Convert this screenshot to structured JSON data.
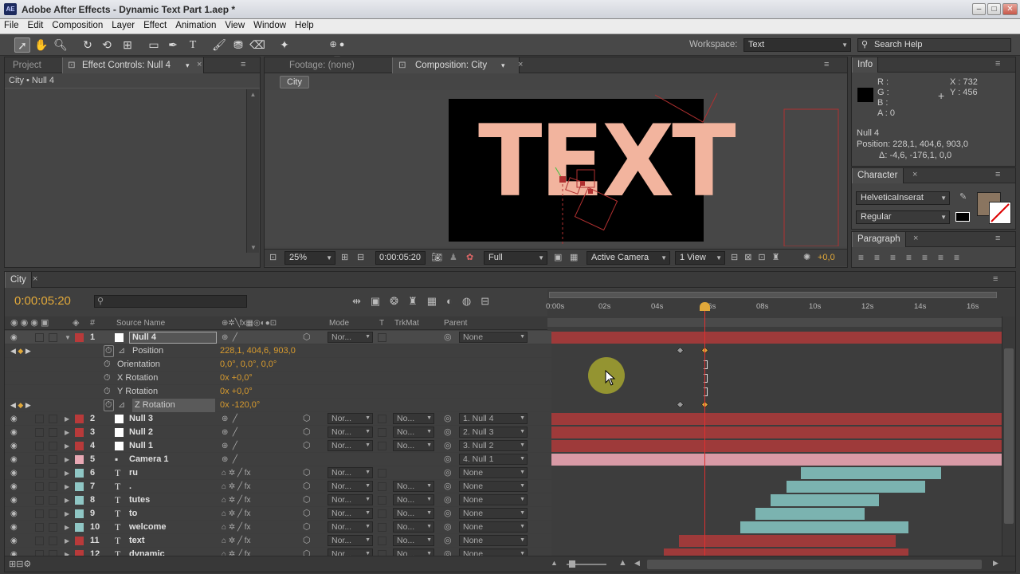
{
  "app": {
    "icon_text": "AE",
    "title": "Adobe After Effects - Dynamic Text Part 1.aep *"
  },
  "window_controls": [
    "–",
    "□",
    "✕"
  ],
  "menu": [
    "File",
    "Edit",
    "Composition",
    "Layer",
    "Effect",
    "Animation",
    "View",
    "Window",
    "Help"
  ],
  "toolbar": {
    "workspace_label": "Workspace:",
    "workspace_value": "Text",
    "search_placeholder": "Search Help"
  },
  "effect_controls": {
    "tab_project": "Project",
    "tab_effects": "Effect Controls: Null 4",
    "breadcrumb": "City • Null 4"
  },
  "composition": {
    "tab_footage": "Footage: (none)",
    "tab_comp": "Composition: City",
    "crumb": "City",
    "canvas_text": "TEXT",
    "zoom": "25%",
    "timecode": "0:00:05:20",
    "resolution": "Full",
    "camera": "Active Camera",
    "view": "1 View",
    "exposure": "+0,0"
  },
  "info": {
    "tab": "Info",
    "r": "R :",
    "g": "G :",
    "b": "B :",
    "a": "A : 0",
    "x": "X : 732",
    "y": "Y : 456",
    "layer": "Null 4",
    "position": "Position: 228,1, 404,6, 903,0",
    "delta": "Δ: -4,6, -176,1, 0,0"
  },
  "character": {
    "tab": "Character",
    "font": "HelveticaInserat",
    "style": "Regular"
  },
  "paragraph": {
    "tab": "Paragraph"
  },
  "timeline": {
    "tab": "City",
    "timecode": "0:00:05:20",
    "headers": {
      "source": "Source Name",
      "mode": "Mode",
      "t": "T",
      "trkmat": "TrkMat",
      "parent": "Parent",
      "num": "#"
    },
    "ruler": [
      "0:00s",
      "02s",
      "04s",
      "06s",
      "08s",
      "10s",
      "12s",
      "14s",
      "16s"
    ],
    "layers": [
      {
        "num": "1",
        "name": "Null 4",
        "color": "#b83a3a",
        "type": "null",
        "mode": "Nor...",
        "trk": "",
        "parent": "None"
      },
      {
        "num": "2",
        "name": "Null 3",
        "color": "#b83a3a",
        "type": "null",
        "mode": "Nor...",
        "trk": "No...",
        "parent": "1. Null 4"
      },
      {
        "num": "3",
        "name": "Null 2",
        "color": "#b83a3a",
        "type": "null",
        "mode": "Nor...",
        "trk": "No...",
        "parent": "2. Null 3"
      },
      {
        "num": "4",
        "name": "Null 1",
        "color": "#b83a3a",
        "type": "null",
        "mode": "Nor...",
        "trk": "No...",
        "parent": "3. Null 2"
      },
      {
        "num": "5",
        "name": "Camera 1",
        "color": "#e8a8b4",
        "type": "camera",
        "mode": "",
        "trk": "",
        "parent": "4. Null 1"
      },
      {
        "num": "6",
        "name": "ru",
        "color": "#8fc6c4",
        "type": "text",
        "mode": "Nor...",
        "trk": "",
        "parent": "None"
      },
      {
        "num": "7",
        "name": ".",
        "color": "#8fc6c4",
        "type": "text",
        "mode": "Nor...",
        "trk": "No...",
        "parent": "None"
      },
      {
        "num": "8",
        "name": "tutes",
        "color": "#8fc6c4",
        "type": "text",
        "mode": "Nor...",
        "trk": "No...",
        "parent": "None"
      },
      {
        "num": "9",
        "name": "to",
        "color": "#8fc6c4",
        "type": "text",
        "mode": "Nor...",
        "trk": "No...",
        "parent": "None"
      },
      {
        "num": "10",
        "name": "welcome",
        "color": "#8fc6c4",
        "type": "text",
        "mode": "Nor...",
        "trk": "No...",
        "parent": "None"
      },
      {
        "num": "11",
        "name": "text",
        "color": "#b83a3a",
        "type": "text",
        "mode": "Nor...",
        "trk": "No...",
        "parent": "None"
      },
      {
        "num": "12",
        "name": "dynamic",
        "color": "#b83a3a",
        "type": "text",
        "mode": "Nor...",
        "trk": "No...",
        "parent": "None"
      }
    ],
    "props": [
      {
        "name": "Position",
        "value": "228,1, 404,6, 903,0",
        "keyed": true
      },
      {
        "name": "Orientation",
        "value": "0,0°, 0,0°, 0,0°",
        "keyed": false
      },
      {
        "name": "X Rotation",
        "value": "0x +0,0°",
        "keyed": false
      },
      {
        "name": "Y Rotation",
        "value": "0x +0,0°",
        "keyed": false
      },
      {
        "name": "Z Rotation",
        "value": "0x -120,0°",
        "keyed": true
      }
    ]
  },
  "colors": {
    "accent": "#e2a93a",
    "null_label": "#b83a3a",
    "text_label": "#8fc6c4",
    "camera_label": "#e8a8b4",
    "bar_red": "#9e3a3a",
    "bar_teal": "#7bb3b0",
    "bar_pink": "#d99aa6",
    "canvas_text": "#f2b49e"
  }
}
